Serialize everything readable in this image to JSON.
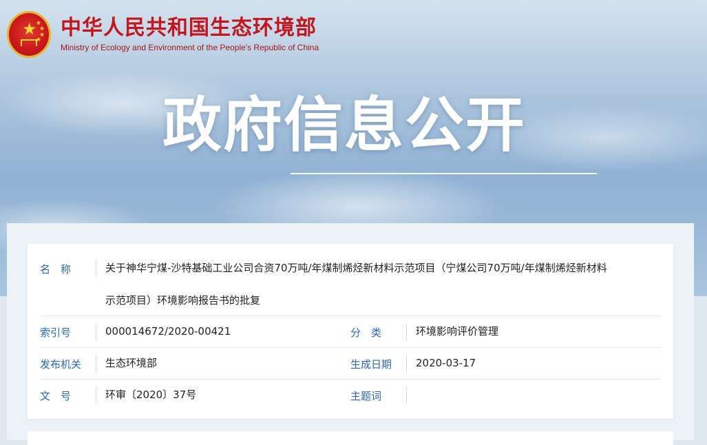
{
  "header": {
    "name_cn": "中华人民共和国生态环境部",
    "name_en": "Ministry of Ecology and Environment of the People's Republic of China"
  },
  "hero": {
    "title": "政府信息公开"
  },
  "info": {
    "name_label": "名　称",
    "name_value_line1": "关于神华宁煤-沙特基础工业公司合资70万吨/年煤制烯烃新材料示范项目（宁煤公司70万吨/年煤制烯烃新材料",
    "name_value_line2": "示范项目）环境影响报告书的批复",
    "index_label": "索引号",
    "index_value": "000014672/2020-00421",
    "category_label": "分　类",
    "category_value": "环境影响评价管理",
    "issuer_label": "发布机关",
    "issuer_value": "生态环境部",
    "date_label": "生成日期",
    "date_value": "2020-03-17",
    "docno_label": "文　号",
    "docno_value": "环审〔2020〕37号",
    "keyword_label": "主题词",
    "keyword_value": ""
  },
  "colors": {
    "brand_red": "#c3151d",
    "label_blue": "#2b67b5"
  }
}
